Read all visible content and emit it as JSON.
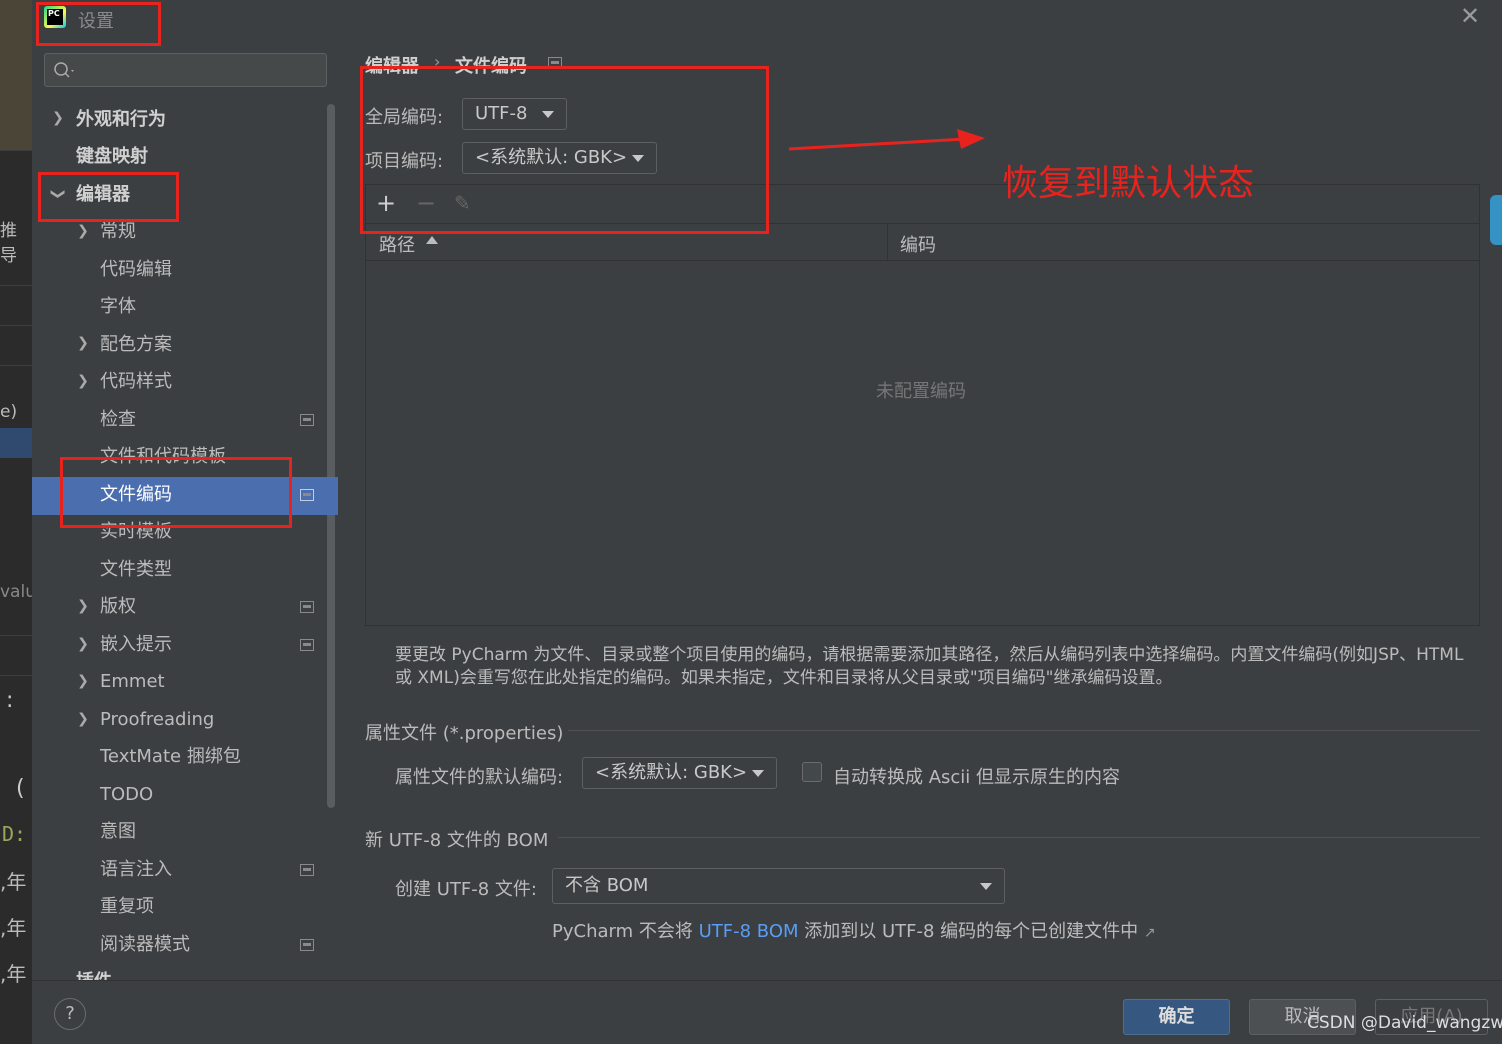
{
  "window": {
    "title": "设置"
  },
  "search": {
    "placeholder": ""
  },
  "sidebar": {
    "items": [
      {
        "label": "外观和行为"
      },
      {
        "label": "键盘映射"
      },
      {
        "label": "编辑器"
      },
      {
        "label": "常规"
      },
      {
        "label": "代码编辑"
      },
      {
        "label": "字体"
      },
      {
        "label": "配色方案"
      },
      {
        "label": "代码样式"
      },
      {
        "label": "检查"
      },
      {
        "label": "文件和代码模板"
      },
      {
        "label": "文件编码"
      },
      {
        "label": "实时模板"
      },
      {
        "label": "文件类型"
      },
      {
        "label": "版权"
      },
      {
        "label": "嵌入提示"
      },
      {
        "label": "Emmet"
      },
      {
        "label": "Proofreading"
      },
      {
        "label": "TextMate 捆绑包"
      },
      {
        "label": "TODO"
      },
      {
        "label": "意图"
      },
      {
        "label": "语言注入"
      },
      {
        "label": "重复项"
      },
      {
        "label": "阅读器模式"
      },
      {
        "label": "插件"
      }
    ]
  },
  "breadcrumb": {
    "parent": "编辑器",
    "separator": "›",
    "current": "文件编码"
  },
  "encoding": {
    "global_label": "全局编码:",
    "global_value": "UTF-8",
    "project_label": "项目编码:",
    "project_value": "<系统默认: GBK>"
  },
  "table": {
    "col_path": "路径",
    "col_encoding": "编码",
    "empty_text": "未配置编码"
  },
  "description": {
    "line1": "要更改 PyCharm 为文件、目录或整个项目使用的编码，请根据需要添加其路径，然后从编码列表中选择编码。内置文件编码(例如JSP、HTML",
    "line2": "或 XML)会重写您在此处指定的编码。如果未指定，文件和目录将从父目录或\"项目编码\"继承编码设置。"
  },
  "properties": {
    "section_title": "属性文件 (*.properties)",
    "default_label": "属性文件的默认编码:",
    "default_value": "<系统默认: GBK>",
    "ascii_label": "自动转换成 Ascii 但显示原生的内容"
  },
  "bom": {
    "section_title": "新 UTF-8 文件的 BOM",
    "create_label": "创建 UTF-8 文件:",
    "create_value": "不含 BOM",
    "note_prefix": "PyCharm 不会将",
    "note_link": "UTF-8 BOM",
    "note_suffix": "添加到以 UTF-8 编码的每个已创建文件中"
  },
  "footer": {
    "help": "?",
    "ok": "确定",
    "cancel": "取消",
    "apply": "应用(A)"
  },
  "annotation": {
    "text": "恢复到默认状态"
  },
  "background": {
    "frag1": "推导",
    "frag2": "e)",
    "frag3": "valu",
    "frag4": ":",
    "frag5": "(",
    "frag6": "D:",
    "frag7": ",年",
    "frag8": ",年",
    "frag9": ",年"
  },
  "watermark": {
    "text": "CSDN @David_wangzw"
  },
  "colors": {
    "accent": "#4b6eaf",
    "selection": "#4b6eaf",
    "link": "#589df6",
    "annotation": "#e8231e",
    "ok_button": "#365880"
  }
}
